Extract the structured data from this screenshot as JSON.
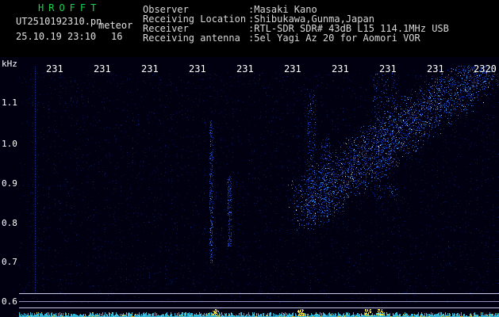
{
  "header": {
    "app_name": "HROFFT",
    "file_name": "UT2510192310.pn",
    "file_suffix": "meteor",
    "datetime": "25.10.19 23:10",
    "channel": "16",
    "observer_label": "Observer",
    "observer_value": ":Masaki Kano",
    "location_label": "Receiving Location",
    "location_value": ":Shibukawa,Gunma,Japan",
    "receiver_label": "Receiver",
    "receiver_value": ":RTL-SDR SDR# 43dB L15 114.1MHz USB",
    "antenna_label": "Receiving antenna",
    "antenna_value": ":5el Yagi Az 20 for Aomori VOR"
  },
  "plot": {
    "y_unit": "kHz",
    "y_ticks": [
      "1.1",
      "1.0",
      "0.9",
      "0.8",
      "0.7",
      "0.6"
    ],
    "x_ticks": [
      "231",
      "231",
      "231",
      "231",
      "231",
      "231",
      "231",
      "231",
      "231",
      "2320"
    ],
    "colors": {
      "background": "#000010",
      "signal_low": "#1a3cc8",
      "signal_mid": "#3aa0ff",
      "signal_high": "#e8f8ff",
      "baseline_yellow": "#ffe840",
      "baseline_cyan": "#39c8e8"
    }
  }
}
